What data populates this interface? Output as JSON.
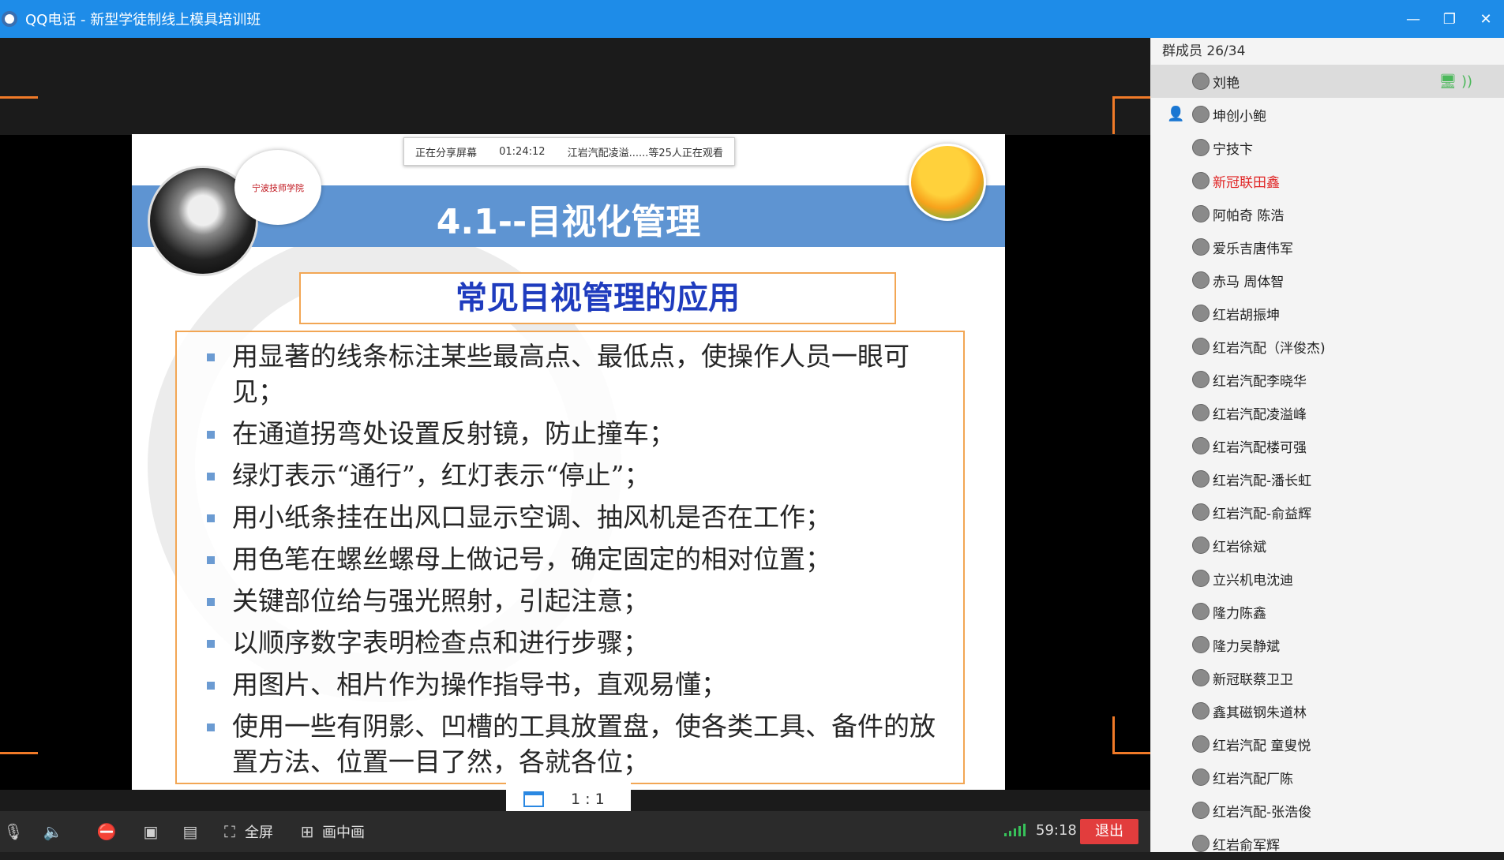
{
  "window": {
    "title": "QQ电话 - 新型学徒制线上模具培训班",
    "controls": [
      "—",
      "❐",
      "✕"
    ]
  },
  "slide": {
    "share_bar": {
      "status": "正在分享屏幕",
      "elapsed": "01:24:12",
      "viewers": "江岩汽配凌溢......等25人正在观看"
    },
    "school_logo_text": "宁波技师学院",
    "heading": "4.1--目视化管理",
    "subtitle": "常见目视管理的应用",
    "bullets": [
      "用显著的线条标注某些最高点、最低点，使操作人员一眼可见；",
      "在通道拐弯处设置反射镜，防止撞车；",
      "绿灯表示“通行”，红灯表示“停止”；",
      "用小纸条挂在出风口显示空调、抽风机是否在工作；",
      "用色笔在螺丝螺母上做记号，确定固定的相对位置；",
      "关键部位给与强光照射，引起注意；",
      "以顺序数字表明检查点和进行步骤；",
      "用图片、相片作为操作指导书，直观易懂；",
      "使用一些有阴影、凹槽的工具放置盘，使各类工具、备件的放置方法、位置一目了然，各就各位；"
    ]
  },
  "ratio_control": {
    "label": "1 : 1"
  },
  "bottom_bar": {
    "fullscreen_label": "全屏",
    "pip_label": "画中画",
    "timer": "59:18",
    "exit_label": "退出"
  },
  "sidebar": {
    "count_label": "群成员 26/34",
    "members": [
      {
        "name": "刘艳",
        "active": true,
        "status": true
      },
      {
        "name": "坤创小鲍",
        "host": true
      },
      {
        "name": "宁技卞"
      },
      {
        "name": "新冠联田鑫",
        "red": true
      },
      {
        "name": "阿帕奇  陈浩"
      },
      {
        "name": "爱乐吉唐伟军"
      },
      {
        "name": "赤马 周体智"
      },
      {
        "name": "红岩胡振坤"
      },
      {
        "name": "红岩汽配（泮俊杰)"
      },
      {
        "name": "红岩汽配李晓华"
      },
      {
        "name": "红岩汽配凌溢峰"
      },
      {
        "name": "红岩汽配楼可强"
      },
      {
        "name": "红岩汽配-潘长虹"
      },
      {
        "name": "红岩汽配-俞益辉"
      },
      {
        "name": "红岩徐斌"
      },
      {
        "name": "立兴机电沈迪"
      },
      {
        "name": "隆力陈鑫"
      },
      {
        "name": "隆力吴静斌"
      },
      {
        "name": "新冠联蔡卫卫"
      },
      {
        "name": "鑫其磁钢朱道林"
      },
      {
        "name": "红岩汽配 童叟悦"
      },
      {
        "name": "红岩汽配厂陈"
      },
      {
        "name": "红岩汽配-张浩俊"
      },
      {
        "name": "红岩俞军辉"
      }
    ]
  },
  "colors": {
    "titlebar": "#1e8ce8",
    "accent_orange": "#f07a28",
    "exit_red": "#e23d3d",
    "slide_banner": "#5e94d2",
    "subtitle_blue": "#1f3cbe"
  }
}
